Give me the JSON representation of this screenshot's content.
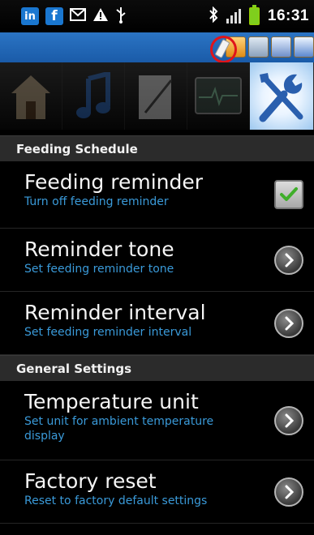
{
  "status_bar": {
    "time": "16:31",
    "icons": [
      "linkedin-icon",
      "facebook-icon",
      "mail-icon",
      "warning-icon",
      "usb-icon",
      "bluetooth-icon",
      "signal-icon",
      "battery-icon"
    ]
  },
  "toolbar": {
    "icons": [
      "pen-icon",
      "calendar-icon",
      "controls-icon",
      "contacts-icon",
      "translate-icon"
    ],
    "highlight_color": "#e0141b"
  },
  "tabs": [
    {
      "icon": "home-icon",
      "active": false
    },
    {
      "icon": "music-icon",
      "active": false
    },
    {
      "icon": "notes-icon",
      "active": false
    },
    {
      "icon": "monitor-icon",
      "active": false
    },
    {
      "icon": "settings-tools-icon",
      "active": true
    }
  ],
  "sections": {
    "feeding": {
      "header": "Feeding Schedule",
      "items": [
        {
          "title": "Feeding reminder",
          "subtitle": "Turn off feeding reminder",
          "control": "checkbox",
          "checked": true
        },
        {
          "title": "Reminder tone",
          "subtitle": "Set feeding reminder tone",
          "control": "arrow"
        },
        {
          "title": "Reminder interval",
          "subtitle": "Set feeding reminder interval",
          "control": "arrow"
        }
      ]
    },
    "general": {
      "header": "General Settings",
      "items": [
        {
          "title": "Temperature unit",
          "subtitle": "Set unit for ambient temperature display",
          "control": "arrow"
        },
        {
          "title": "Factory reset",
          "subtitle": "Reset to factory default settings",
          "control": "arrow"
        }
      ]
    }
  },
  "colors": {
    "accent_blue": "#3a9ad9",
    "toolbar_blue": "#2b74c4",
    "check_green": "#3fae2a"
  }
}
